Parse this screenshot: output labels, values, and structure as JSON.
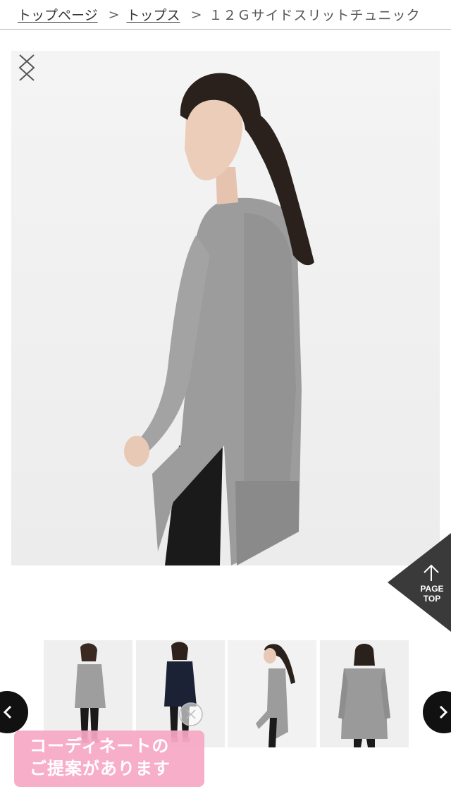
{
  "breadcrumb": {
    "items": [
      {
        "label": "トップページ"
      },
      {
        "label": "トップス"
      }
    ],
    "separator": ">",
    "current": "１２Ｇサイドスリットチュニック"
  },
  "gallery": {
    "main_image": "model-side-view-gray-tunic",
    "prev_icon": "chevron-left-icon",
    "next_icon": "chevron-right-icon",
    "thumbnails": [
      {
        "image": "gray-tunic-front"
      },
      {
        "image": "navy-tunic-front"
      },
      {
        "image": "gray-tunic-side"
      },
      {
        "image": "gray-tunic-back"
      }
    ]
  },
  "page_top": {
    "line1": "PAGE",
    "line2": "TOP",
    "icon": "arrow-up-icon"
  },
  "coordinate_banner": {
    "line1": "コーディネートの",
    "line2": "ご提案があります"
  },
  "colors": {
    "banner_pink": "#f6a8c4",
    "page_top_bg": "#3a3a3a",
    "carousel_button": "#111111",
    "sweater_gray": "#9a9a9a"
  }
}
